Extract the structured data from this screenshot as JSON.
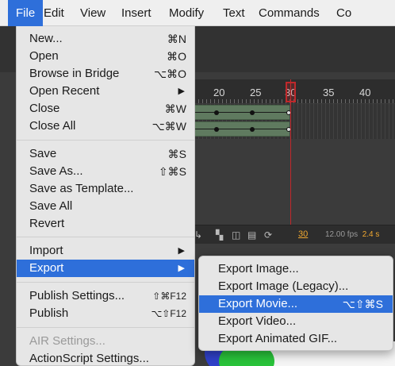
{
  "menubar": {
    "items": [
      {
        "label": "File"
      },
      {
        "label": "Edit"
      },
      {
        "label": "View"
      },
      {
        "label": "Insert"
      },
      {
        "label": "Modify"
      },
      {
        "label": "Text"
      },
      {
        "label": "Commands"
      },
      {
        "label": "Co"
      }
    ],
    "active": "File"
  },
  "file_menu": {
    "items": [
      {
        "label": "New...",
        "shortcut": "⌘N"
      },
      {
        "label": "Open",
        "shortcut": "⌘O"
      },
      {
        "label": "Browse in Bridge",
        "shortcut": "⌥⌘O"
      },
      {
        "label": "Open Recent",
        "submenu": "▶"
      },
      {
        "label": "Close",
        "shortcut": "⌘W"
      },
      {
        "label": "Close All",
        "shortcut": "⌥⌘W"
      },
      {
        "label": "Save",
        "shortcut": "⌘S"
      },
      {
        "label": "Save As...",
        "shortcut": "⇧⌘S"
      },
      {
        "label": "Save as Template..."
      },
      {
        "label": "Save All"
      },
      {
        "label": "Revert"
      },
      {
        "label": "Import",
        "submenu": "▶"
      },
      {
        "label": "Export",
        "submenu": "▶",
        "highlighted": true
      },
      {
        "label": "Publish Settings...",
        "shortcut": "⇧⌘F12"
      },
      {
        "label": "Publish",
        "shortcut": "⌥⇧F12"
      },
      {
        "label": "AIR Settings...",
        "disabled": true
      },
      {
        "label": "ActionScript Settings..."
      }
    ]
  },
  "export_menu": {
    "items": [
      {
        "label": "Export Image..."
      },
      {
        "label": "Export Image (Legacy)..."
      },
      {
        "label": "Export Movie...",
        "shortcut": "⌥⇧⌘S",
        "highlighted": true
      },
      {
        "label": "Export Video..."
      },
      {
        "label": "Export Animated GIF..."
      }
    ]
  },
  "timeline": {
    "ruler_labels": [
      "20",
      "25",
      "30",
      "35",
      "40"
    ],
    "current_frame": "30",
    "fps": "12.00 fps",
    "seconds": "2.4 s",
    "status_icons": [
      "onion-skin-icon",
      "onion-outline-icon",
      "edit-multiple-frames-icon",
      "loop-icon"
    ]
  },
  "colors": {
    "highlight": "#2e6fda",
    "menu_bg": "#e6e6e6",
    "playhead": "#c0282b",
    "tween": "#5f7a5f",
    "accent_orange": "#f0a830"
  }
}
